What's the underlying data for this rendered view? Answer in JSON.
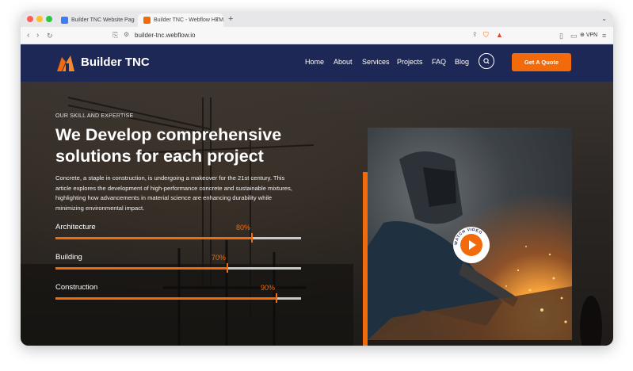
{
  "browser": {
    "tabs": [
      {
        "title": "Builder TNC Website Page Templ...",
        "active": false
      },
      {
        "title": "Builder TNC - Webflow HTML...",
        "active": true
      }
    ],
    "new_tab": "+",
    "url": "builder-tnc.webflow.io",
    "vpn_label": "VPN"
  },
  "site": {
    "brand": "Builder TNC",
    "nav": [
      "Home",
      "About",
      "Services",
      "Projects",
      "FAQ",
      "Blog"
    ],
    "cta": "Get A Quote",
    "colors": {
      "accent": "#f26a0a",
      "nav_bg": "#1e2856"
    }
  },
  "hero": {
    "eyebrow": "OUR SKILL AND EXPERTISE",
    "headline": "We Develop comprehensive solutions for each project",
    "description": "Concrete, a staple in construction, is undergoing a makeover for the 21st century. This article explores the development of high-performance concrete and sustainable mixtures, highlighting how advancements in material science are enhancing durability while minimizing environmental impact.",
    "skills": [
      {
        "label": "Architecture",
        "percent_label": "80%",
        "value": 0.8
      },
      {
        "label": "Building",
        "percent_label": "70%",
        "value": 0.7
      },
      {
        "label": "Construction",
        "percent_label": "90%",
        "value": 0.9
      }
    ],
    "video_badge": "WATCH VIDEO"
  }
}
